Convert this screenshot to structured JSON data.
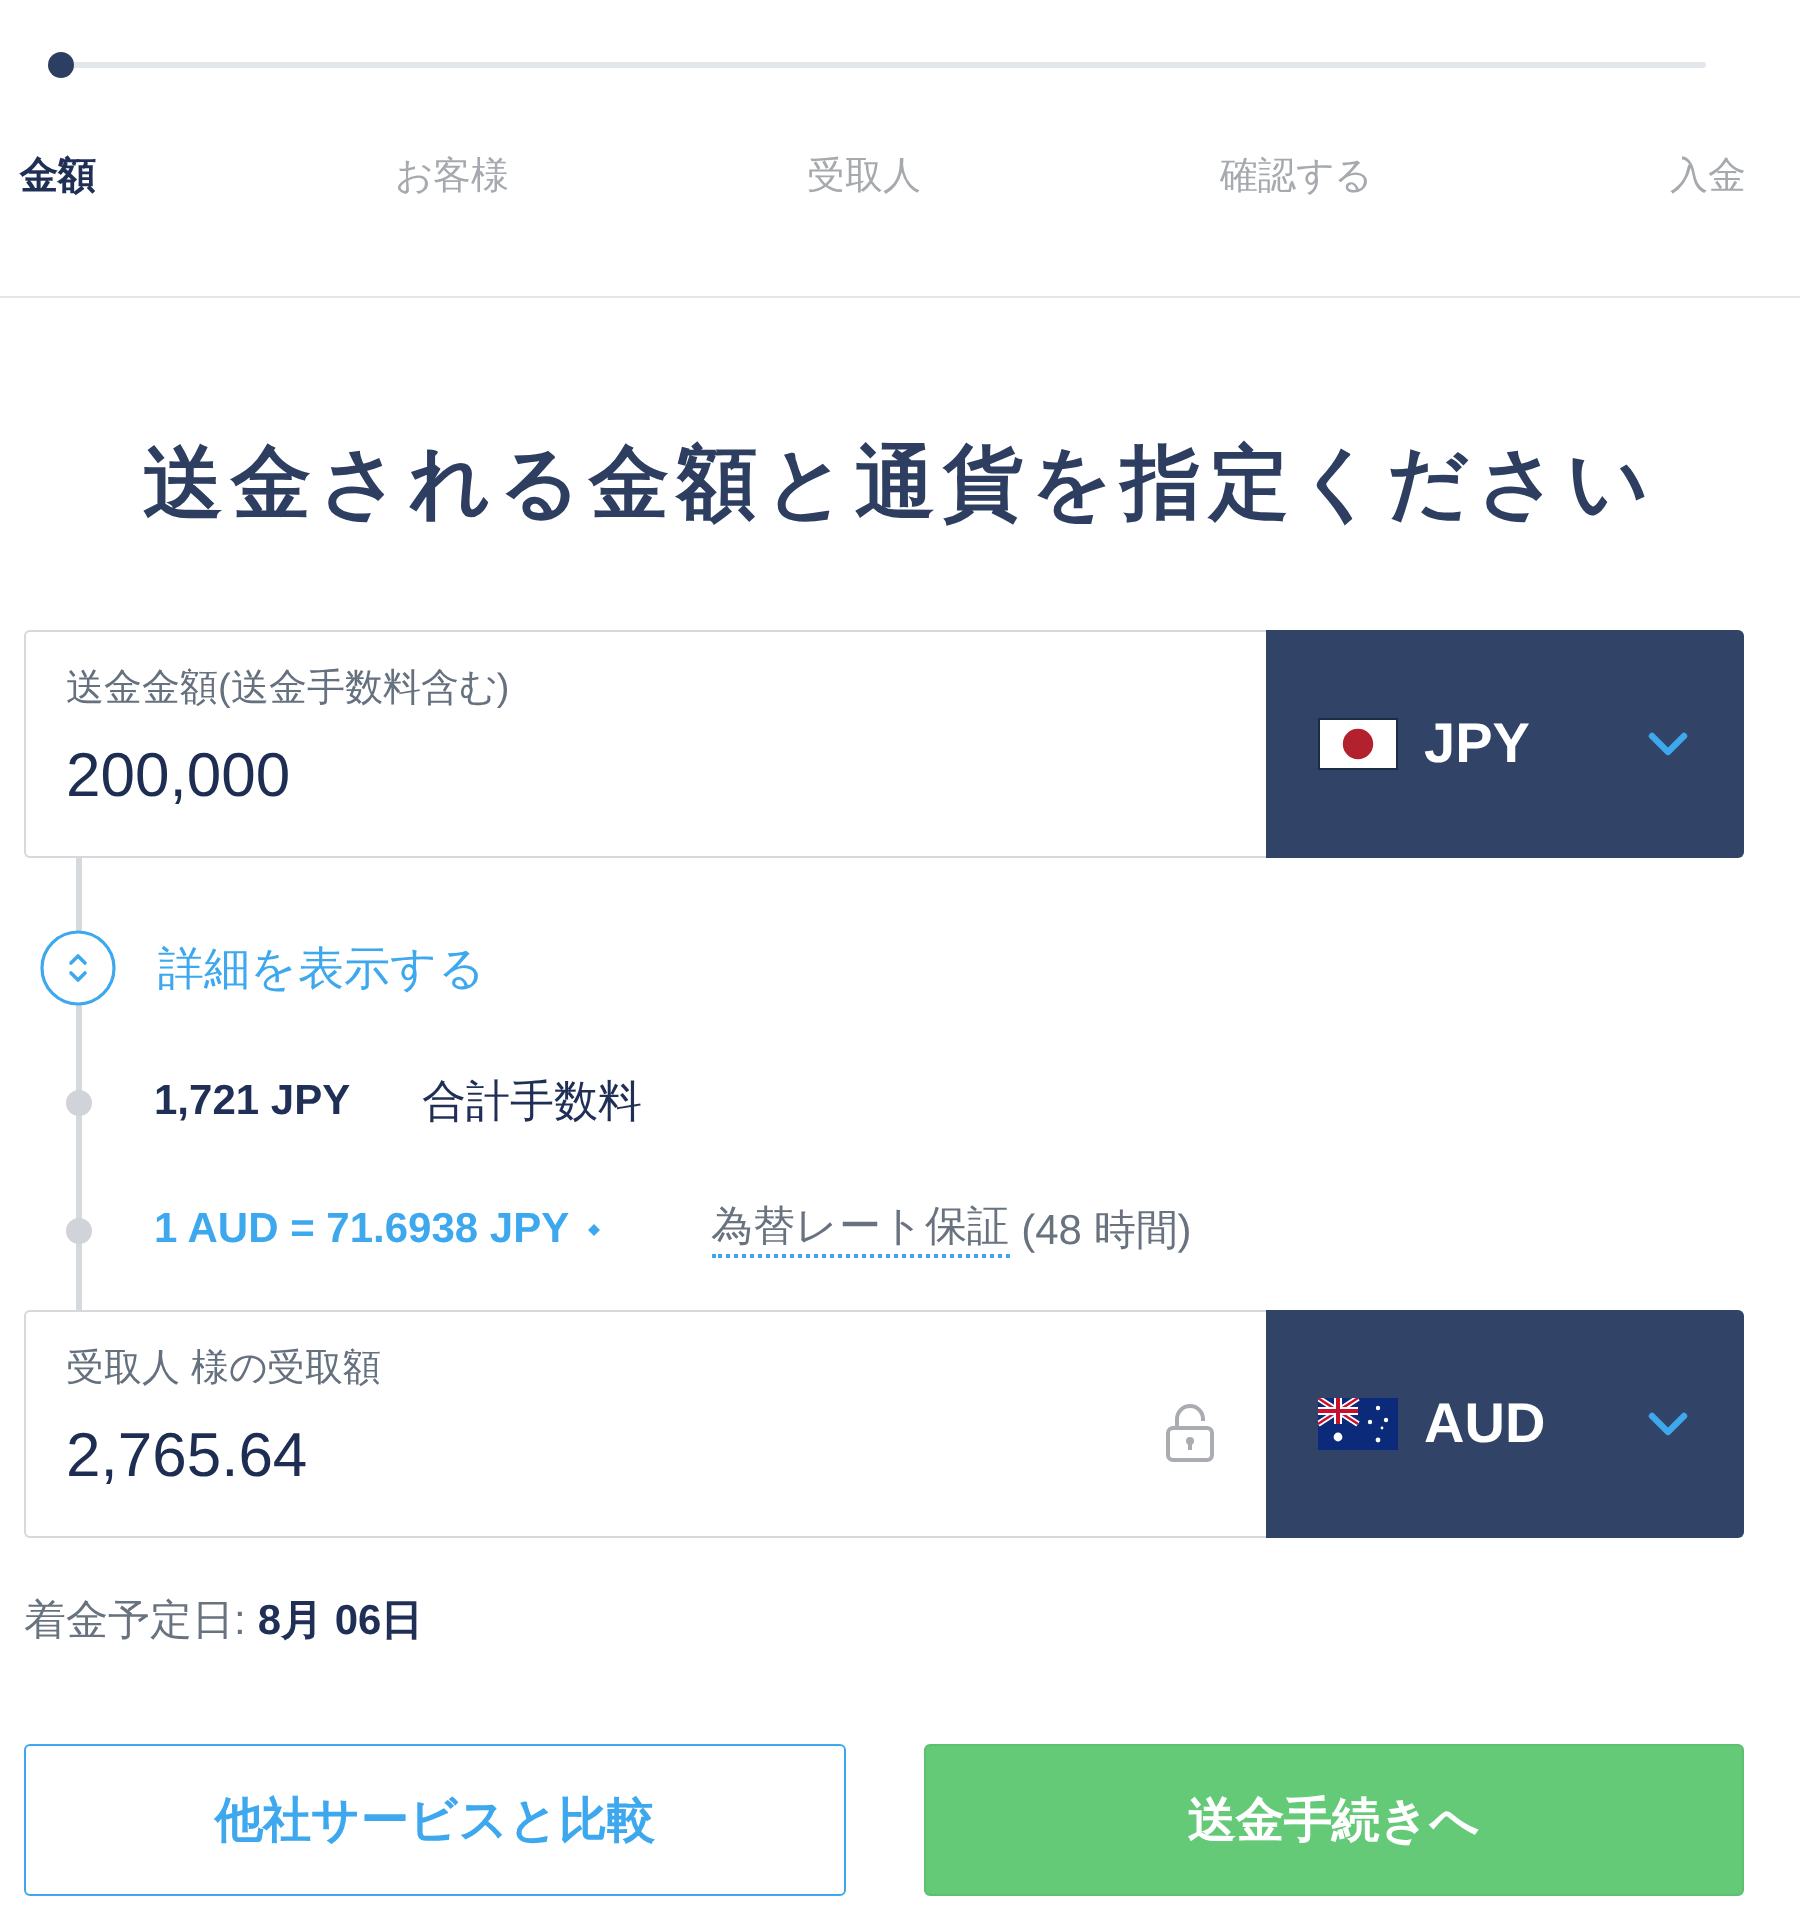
{
  "progress": {
    "level": 0
  },
  "steps": [
    {
      "label": "金額",
      "selected": true
    },
    {
      "label": "お客様",
      "selected": false
    },
    {
      "label": "受取人",
      "selected": false
    },
    {
      "label": "確認する",
      "selected": false
    },
    {
      "label": "入金",
      "selected": false
    }
  ],
  "heading": "送金される金額と通貨を指定ください",
  "send_amount": {
    "label": "送金金額(送金手数料含む)",
    "value": "200,000",
    "currency": "JPY"
  },
  "details": {
    "toggle_label": "詳細を表示する",
    "fee_amount": "1,721 JPY",
    "fee_label": "合計手数料",
    "rate": "1 AUD = 71.6938 JPY",
    "rate_guarantee": "為替レート保証",
    "guarantee_period": "(48 時間)"
  },
  "receive_amount": {
    "label": "受取人 様の受取額",
    "value": "2,765.64",
    "currency": "AUD",
    "locked": false
  },
  "arrival": {
    "label": "着金予定日:",
    "date": "8月 06日"
  },
  "buttons": [
    {
      "label": "他社サービスと比較",
      "kind": "secondary"
    },
    {
      "label": "送金手続きへ",
      "kind": "primary"
    }
  ]
}
